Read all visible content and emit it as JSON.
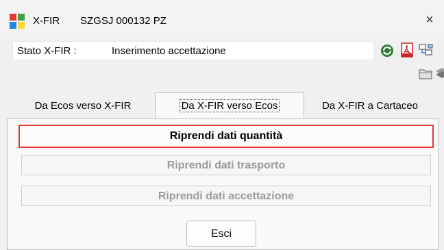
{
  "window": {
    "app_name": "X-FIR",
    "document": "SZGSJ 000132 PZ",
    "close_glyph": "×"
  },
  "status": {
    "label": "Stato X-FIR :",
    "value": "Inserimento accettazione"
  },
  "toolbar": {
    "icons": [
      "refresh-icon",
      "pdf-icon",
      "network-icon",
      "folder-icon",
      "stack-icon"
    ]
  },
  "tabs": [
    {
      "label": "Da Ecos verso X-FIR",
      "active": false
    },
    {
      "label": "Da X-FIR verso Ecos",
      "active": true
    },
    {
      "label": "Da X-FIR a Cartaceo",
      "active": false
    }
  ],
  "actions": {
    "quantita": "Riprendi dati quantità",
    "trasporto": "Riprendi dati trasporto",
    "accettazione": "Riprendi dati accettazione"
  },
  "footer": {
    "exit_label": "Esci"
  },
  "colors": {
    "highlight": "#e53935",
    "disabled_text": "#9b9b9b"
  }
}
